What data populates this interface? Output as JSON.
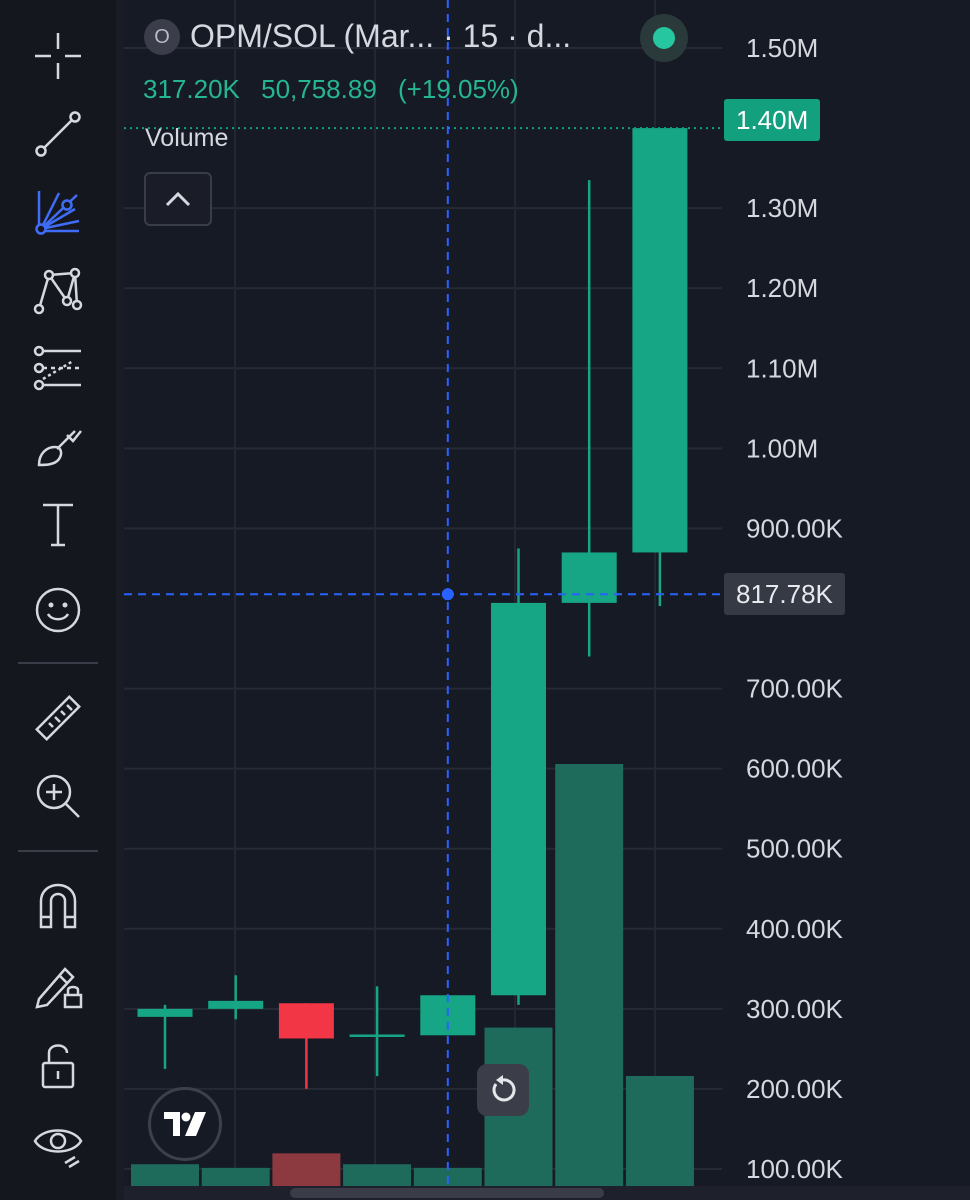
{
  "symbol": {
    "badge": "O",
    "title": "OPM/SOL (Mar... · 15 · d...",
    "open": "317.20K",
    "change": "50,758.89",
    "change_pct": "(+19.05%)"
  },
  "volume_pane": {
    "label": "Volume"
  },
  "toolbar": {
    "tools": [
      "crosshair-icon",
      "trend-line-icon",
      "fib-fan-icon",
      "pattern-icon",
      "prediction-icon",
      "brush-icon",
      "text-icon",
      "emoji-icon",
      "ruler-icon",
      "zoom-in-icon",
      "magnet-icon",
      "lock-drawing-icon",
      "lock-icon",
      "eye-icon"
    ],
    "active_tool": "fib-fan-icon"
  },
  "price_tags": {
    "last": "1.40M",
    "crosshair": "817.78K"
  },
  "colors": {
    "up": "#16a585",
    "down": "#f23645",
    "volume_up": "#1e6b5c",
    "volume_down": "#8c3a3f",
    "crosshair": "#2962ff",
    "last_price": "#13a07f"
  },
  "chart_data": {
    "type": "candlestick",
    "y_tick_labels": [
      "1.50M",
      "1.30M",
      "1.20M",
      "1.10M",
      "1.00M",
      "900.00K",
      "700.00K",
      "600.00K",
      "500.00K",
      "400.00K",
      "300.00K",
      "200.00K",
      "100.00K"
    ],
    "y_ticks": [
      1500000,
      1300000,
      1200000,
      1100000,
      1000000,
      900000,
      700000,
      600000,
      500000,
      400000,
      300000,
      200000,
      100000
    ],
    "ylim": [
      85000,
      1560000
    ],
    "candles": [
      {
        "open": 290000,
        "high": 305000,
        "low": 225000,
        "close": 300000
      },
      {
        "open": 300000,
        "high": 342000,
        "low": 287000,
        "close": 310000
      },
      {
        "open": 307000,
        "high": 307000,
        "low": 200000,
        "close": 263000
      },
      {
        "open": 266000,
        "high": 328000,
        "low": 216000,
        "close": 268000
      },
      {
        "open": 267000,
        "high": 317000,
        "low": 267000,
        "close": 317000
      },
      {
        "open": 317000,
        "high": 875000,
        "low": 305000,
        "close": 807000
      },
      {
        "open": 807000,
        "high": 1335000,
        "low": 740000,
        "close": 870000
      },
      {
        "open": 870000,
        "high": 1400000,
        "low": 803000,
        "close": 1400000
      }
    ],
    "volume": [
      0.036,
      0.03,
      0.054,
      0.036,
      0.03,
      0.262,
      0.698,
      0.182
    ],
    "crosshair": {
      "candle_index": 4,
      "price": 817780
    },
    "last_price": 1400000,
    "grid": true
  }
}
